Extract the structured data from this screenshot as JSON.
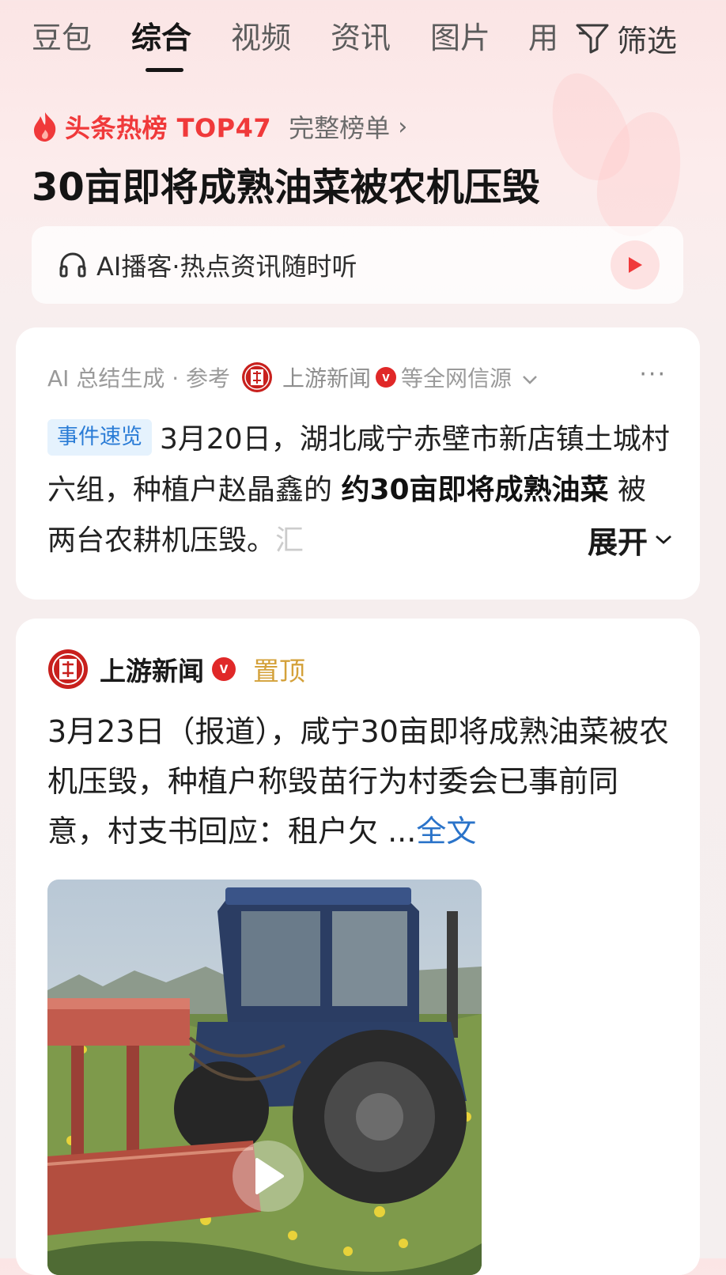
{
  "tabs": [
    {
      "label": "豆包"
    },
    {
      "label": "综合"
    },
    {
      "label": "视频"
    },
    {
      "label": "资讯"
    },
    {
      "label": "图片"
    },
    {
      "label": "用"
    }
  ],
  "active_tab": "综合",
  "filter_label": "筛选",
  "hot": {
    "title": "头条热榜 TOP47",
    "full_list": "完整榜单"
  },
  "main_title": "30亩即将成熟油菜被农机压毁",
  "podcast": {
    "label": "AI播客·热点资讯随时听"
  },
  "summary_card": {
    "ai_label": "AI 总结生成 · 参考",
    "source_name": "上游新闻",
    "source_suffix": "等全网信源",
    "tag": "事件速览",
    "text_1": "3月20日，湖北咸宁赤壁市新店镇土城村六组，种植户赵晶鑫的 ",
    "text_bold": "约30亩即将成熟油菜",
    "text_2": " 被两台农耕机压毁。",
    "text_cut": "汇",
    "expand": "展开"
  },
  "article_card": {
    "source_name": "上游新闻",
    "logo_text": "上游",
    "pinned": "置顶",
    "text": "3月23日（报道），咸宁30亩即将成熟油菜被农机压毁，种植户称毁苗行为村委会已事前同意，村支书回应：租户欠 ...",
    "full_text": "全文"
  },
  "colors": {
    "hot_red": "#f0393a",
    "tag_blue": "#2a7cd6",
    "link_blue": "#2a73c9",
    "pin_gold": "#d4a13a"
  }
}
